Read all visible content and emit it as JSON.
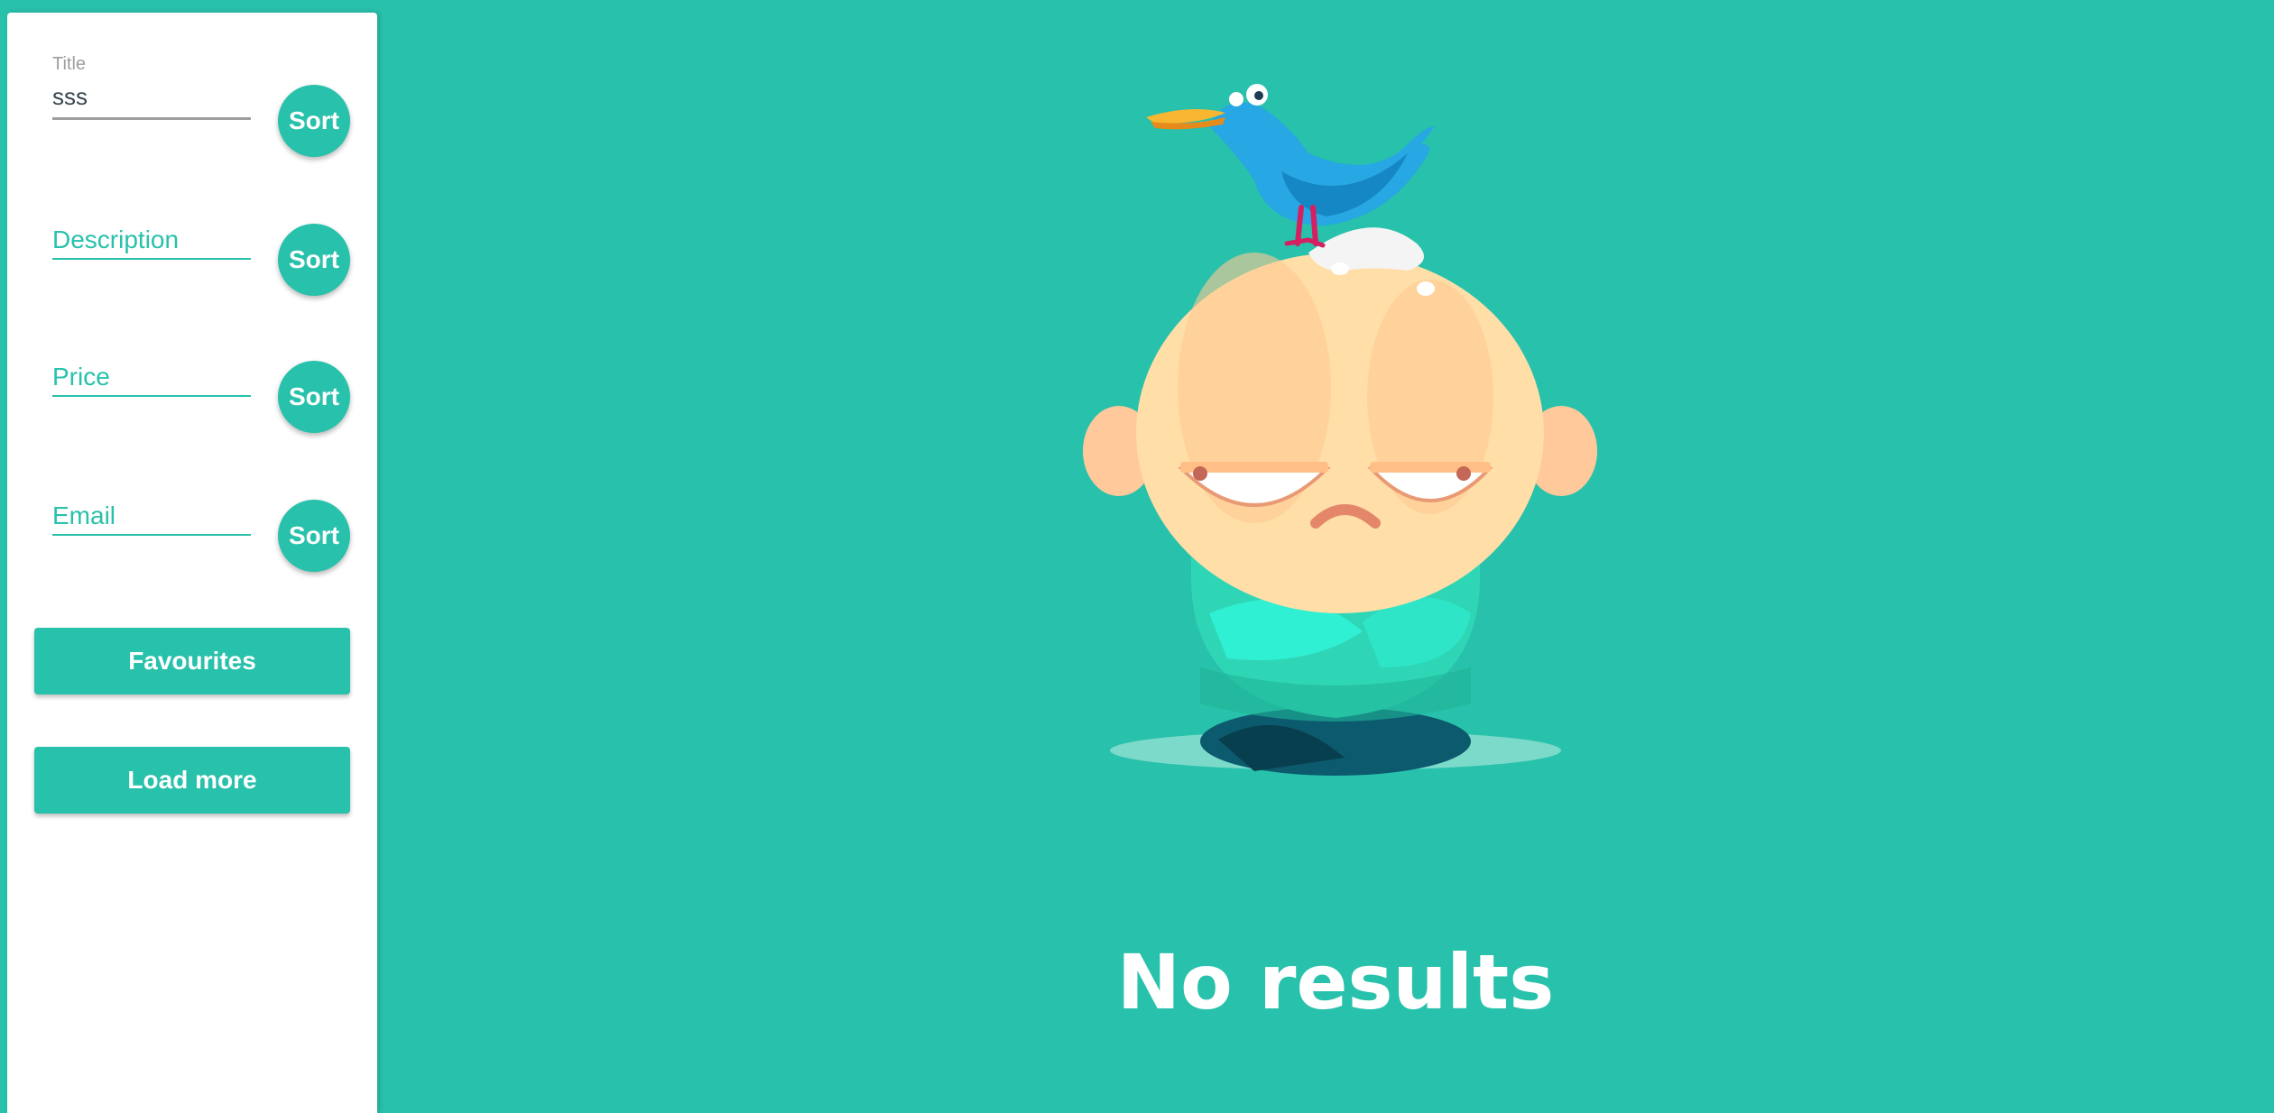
{
  "sidebar": {
    "title_field": {
      "label": "Title",
      "value": "sss",
      "sort_label": "Sort"
    },
    "description_field": {
      "placeholder": "Description",
      "sort_label": "Sort"
    },
    "price_field": {
      "placeholder": "Price",
      "sort_label": "Sort"
    },
    "email_field": {
      "placeholder": "Email",
      "sort_label": "Sort"
    },
    "favourites_label": "Favourites",
    "load_more_label": "Load more"
  },
  "main": {
    "empty_message": "No results",
    "illustration_icon": "grumpy-baby-with-bird-illustration"
  },
  "colors": {
    "accent": "#28c1ab",
    "panel": "#ffffff",
    "muted": "#9e9e9e"
  }
}
